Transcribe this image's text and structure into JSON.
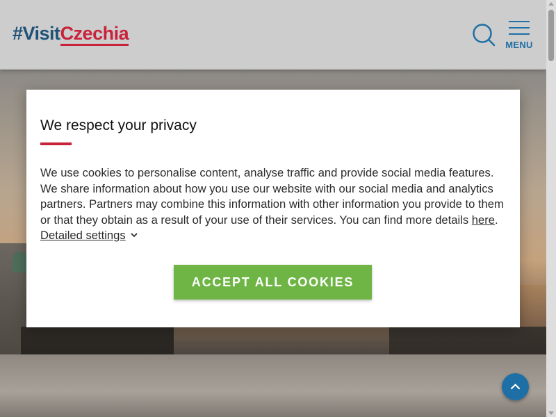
{
  "header": {
    "logo_hash": "#Visit",
    "logo_country": "Czechia",
    "menu_label": "MENU",
    "search_icon": "search-icon",
    "menu_icon": "hamburger-icon"
  },
  "cookie_modal": {
    "title": "We respect your privacy",
    "body_text": "We use cookies to personalise content, analyse traffic and provide social media features. We share information about how you use our website with our social media and analytics partners. Partners may combine this information with other information you provide to them or that they obtain as a result of your use of their services. You can find more details ",
    "here_link": "here",
    "separator": ". ",
    "settings_link": "Detailed settings",
    "accept_button": "ACCEPT ALL COOKIES"
  },
  "back_to_top_icon": "chevron-up-icon",
  "colors": {
    "brand_blue": "#1f5276",
    "accent_red": "#c8233a",
    "accept_green": "#6eb545",
    "link_blue": "#1e6fa5"
  }
}
